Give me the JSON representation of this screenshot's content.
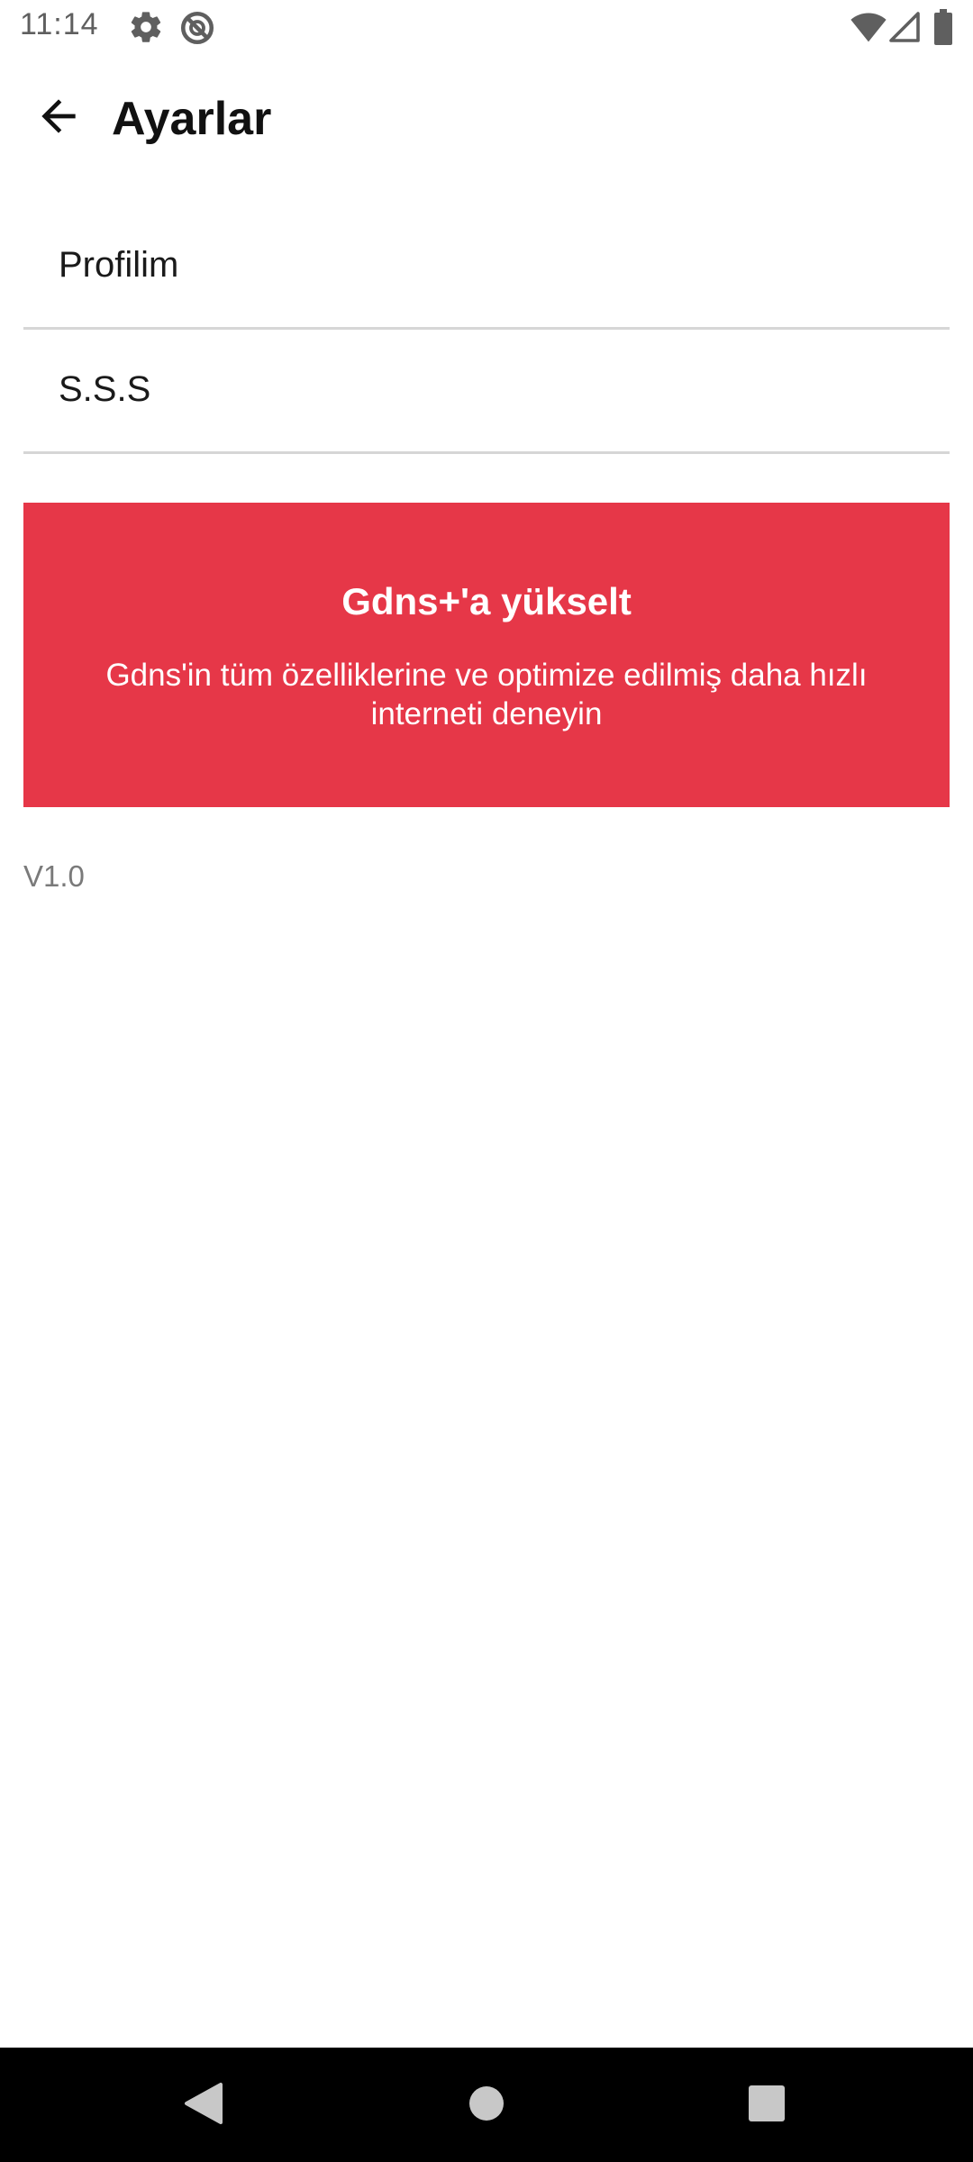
{
  "status_bar": {
    "time": "11:14",
    "icons_left": [
      "gear-icon",
      "do-not-disturb-icon"
    ],
    "icons_right": [
      "wifi-icon",
      "cell-signal-icon",
      "battery-icon"
    ]
  },
  "app_bar": {
    "title": "Ayarlar",
    "back_icon": "arrow-left-icon"
  },
  "menu": {
    "items": [
      {
        "label": "Profilim"
      },
      {
        "label": "S.S.S"
      }
    ]
  },
  "promo": {
    "title": "Gdns+'a yükselt",
    "description": "Gdns'in tüm özelliklerine ve optimize edilmiş daha hızlı interneti deneyin",
    "background_color": "#e63748"
  },
  "footer": {
    "version": "V1.0"
  },
  "nav_bar": {
    "buttons": [
      "back-triangle-icon",
      "home-circle-icon",
      "recents-square-icon"
    ]
  }
}
